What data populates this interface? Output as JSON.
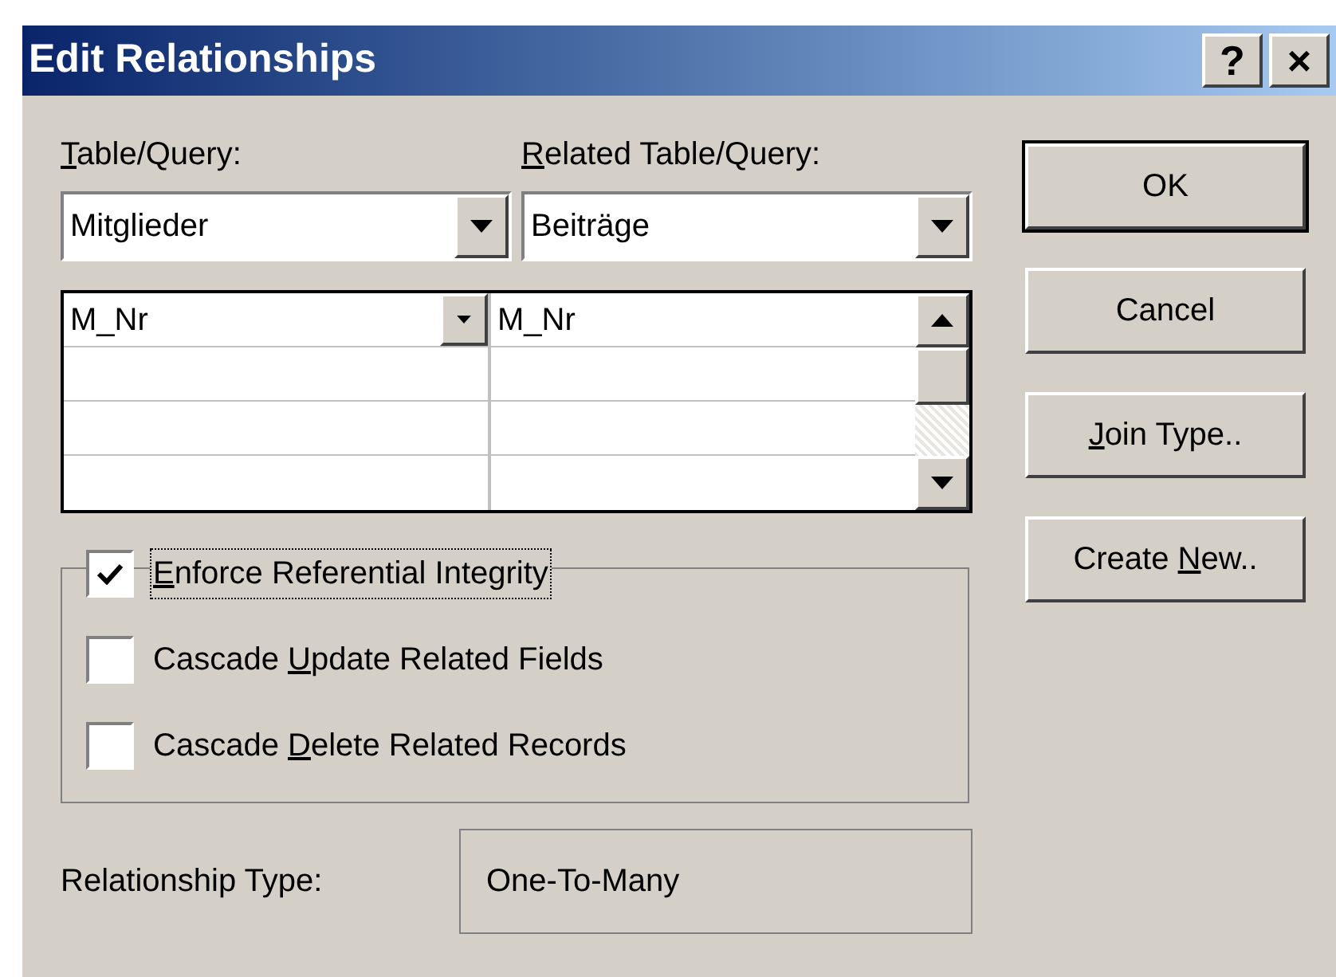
{
  "window": {
    "title": "Edit Relationships",
    "title_buttons": [
      "?",
      "×"
    ]
  },
  "table_query": {
    "label": {
      "key": "T",
      "post": "able/Query:"
    },
    "value": "Mitglieder"
  },
  "related_table_query": {
    "label": {
      "key": "R",
      "post": "elated Table/Query:"
    },
    "value": "Beiträge"
  },
  "fields_grid": {
    "rows": [
      {
        "left": "M_Nr",
        "right": "M_Nr",
        "selected": true
      },
      {
        "selected": false
      },
      {
        "selected": false
      },
      {
        "selected": false
      }
    ]
  },
  "options": [
    {
      "label": {
        "key": "E",
        "post": "nforce Referential Integrity"
      },
      "checked": true,
      "focused": true
    },
    {
      "label": {
        "pre": "Cascade ",
        "key": "U",
        "post": "pdate Related Fields"
      },
      "checked": false,
      "focused": false
    },
    {
      "label": {
        "pre": "Cascade ",
        "key": "D",
        "post": "elete Related Records"
      },
      "checked": false,
      "focused": false
    }
  ],
  "relationship_type": {
    "label": "Relationship Type:",
    "value": "One-To-Many"
  },
  "buttons": [
    {
      "label": {
        "post": "OK"
      },
      "default": true
    },
    {
      "label": {
        "post": "Cancel"
      },
      "default": false
    },
    {
      "label": {
        "key": "J",
        "post": "oin Type.."
      },
      "default": false
    },
    {
      "label": {
        "pre": "Create ",
        "key": "N",
        "post": "ew.."
      },
      "default": false
    }
  ]
}
